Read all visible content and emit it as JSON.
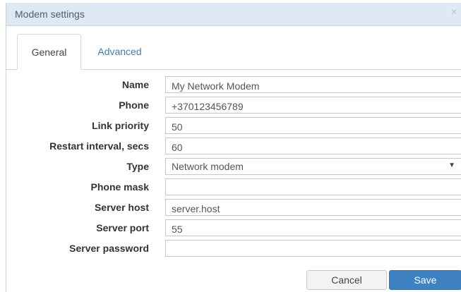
{
  "window": {
    "title": "Modem settings",
    "close_glyph": "×"
  },
  "tabs": [
    {
      "label": "General",
      "active": true
    },
    {
      "label": "Advanced",
      "active": false
    }
  ],
  "form": {
    "name": {
      "label": "Name",
      "value": "My Network Modem"
    },
    "phone": {
      "label": "Phone",
      "value": "+370123456789"
    },
    "link_priority": {
      "label": "Link priority",
      "value": "50"
    },
    "restart_interval": {
      "label": "Restart interval, secs",
      "value": "60"
    },
    "type": {
      "label": "Type",
      "value": "Network modem"
    },
    "phone_mask": {
      "label": "Phone mask",
      "value": ""
    },
    "server_host": {
      "label": "Server host",
      "value": "server.host"
    },
    "server_port": {
      "label": "Server port",
      "value": "55"
    },
    "server_password": {
      "label": "Server password",
      "value": ""
    }
  },
  "buttons": {
    "cancel": "Cancel",
    "save": "Save"
  },
  "icons": {
    "close": "close-icon",
    "dropdown": "chevron-down-icon"
  },
  "colors": {
    "titlebar": "#dfe9f3",
    "link": "#3a7cc0",
    "primary": "#3f82c4"
  }
}
